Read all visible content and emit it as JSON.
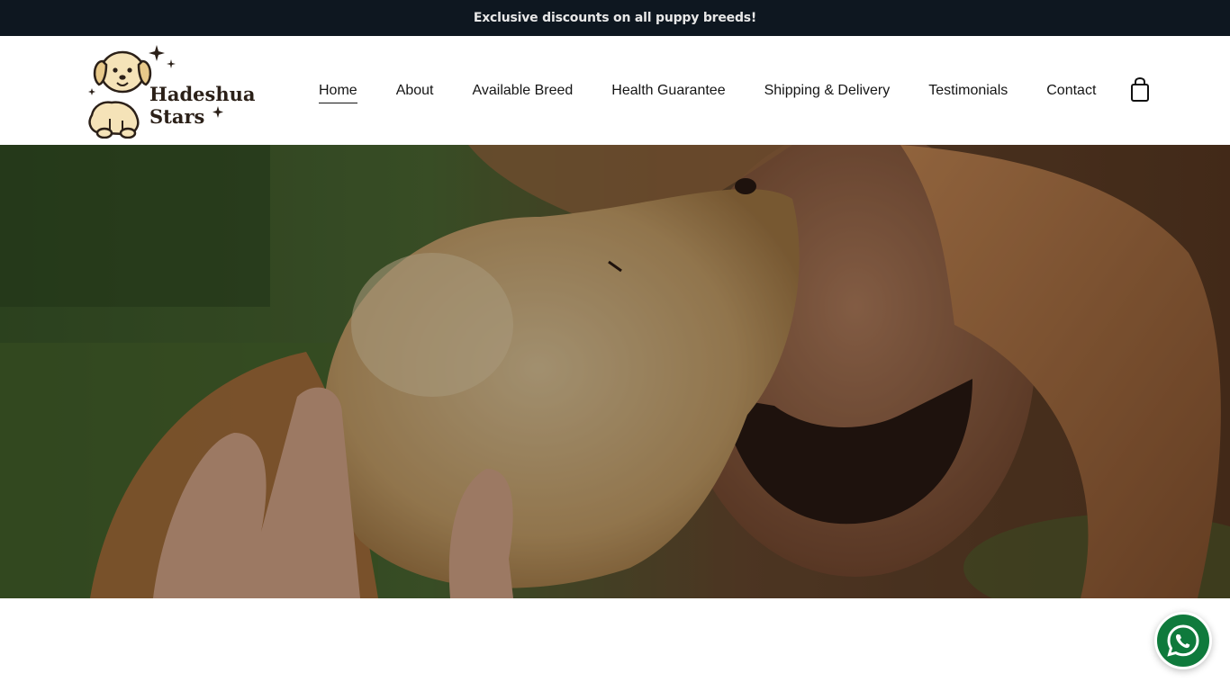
{
  "announcement": "Exclusive discounts on all puppy breeds!",
  "brand": {
    "line1": "Hadeshua",
    "line2": "Stars",
    "icon": "puppy-logo-icon"
  },
  "nav": {
    "items": [
      {
        "label": "Home",
        "active": true
      },
      {
        "label": "About"
      },
      {
        "label": "Available Breed"
      },
      {
        "label": "Health Guarantee"
      },
      {
        "label": "Shipping & Delivery"
      },
      {
        "label": "Testimonials"
      },
      {
        "label": "Contact"
      }
    ],
    "cart_icon": "shopping-bag-icon"
  },
  "hero": {
    "image": "man-with-puppy-photo"
  },
  "floating": {
    "icon": "whatsapp-icon"
  },
  "colors": {
    "announce_bg": "#0e1720",
    "whatsapp": "#0f7a3c",
    "text": "#151515"
  }
}
